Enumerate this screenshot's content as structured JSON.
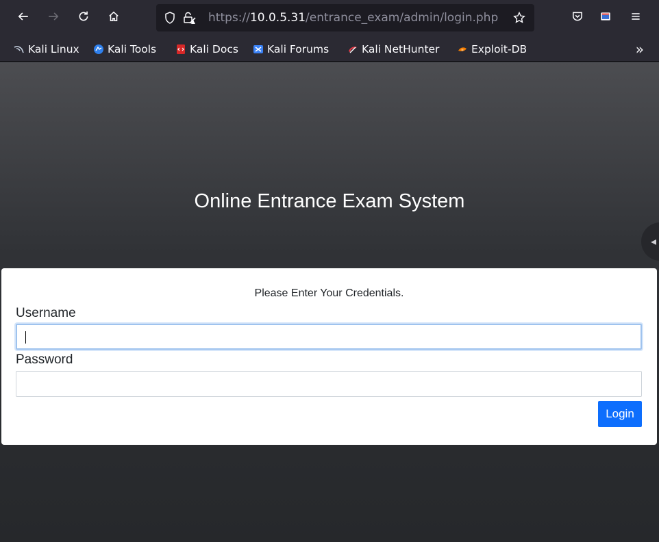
{
  "browser": {
    "url_scheme": "https://",
    "url_host": "10.0.5.31",
    "url_path": "/entrance_exam/admin/login.php",
    "more_bookmarks_glyph": "»"
  },
  "bookmarks": [
    {
      "label": "Kali Linux",
      "icon": "kali-dragon-icon",
      "color": "#3d8bd6"
    },
    {
      "label": "Kali Tools",
      "icon": "kali-tools-icon",
      "color": "#2f80ed"
    },
    {
      "label": "Kali Docs",
      "icon": "kali-docs-icon",
      "color": "#d62828"
    },
    {
      "label": "Kali Forums",
      "icon": "kali-forums-icon",
      "color": "#3b82f6"
    },
    {
      "label": "Kali NetHunter",
      "icon": "kali-nethunter-icon",
      "color": "#e63946"
    },
    {
      "label": "Exploit-DB",
      "icon": "exploit-db-icon",
      "color": "#f77f00"
    }
  ],
  "page": {
    "title": "Online Entrance Exam System",
    "card_subtitle": "Please Enter Your Credentials.",
    "username_label": "Username",
    "username_value": "",
    "password_label": "Password",
    "password_value": "",
    "login_label": "Login"
  },
  "colors": {
    "accent": "#0d6efd",
    "focus_ring": "#9fc3ee",
    "chrome": "#2b2a33",
    "urlbar": "#1c1b22"
  }
}
